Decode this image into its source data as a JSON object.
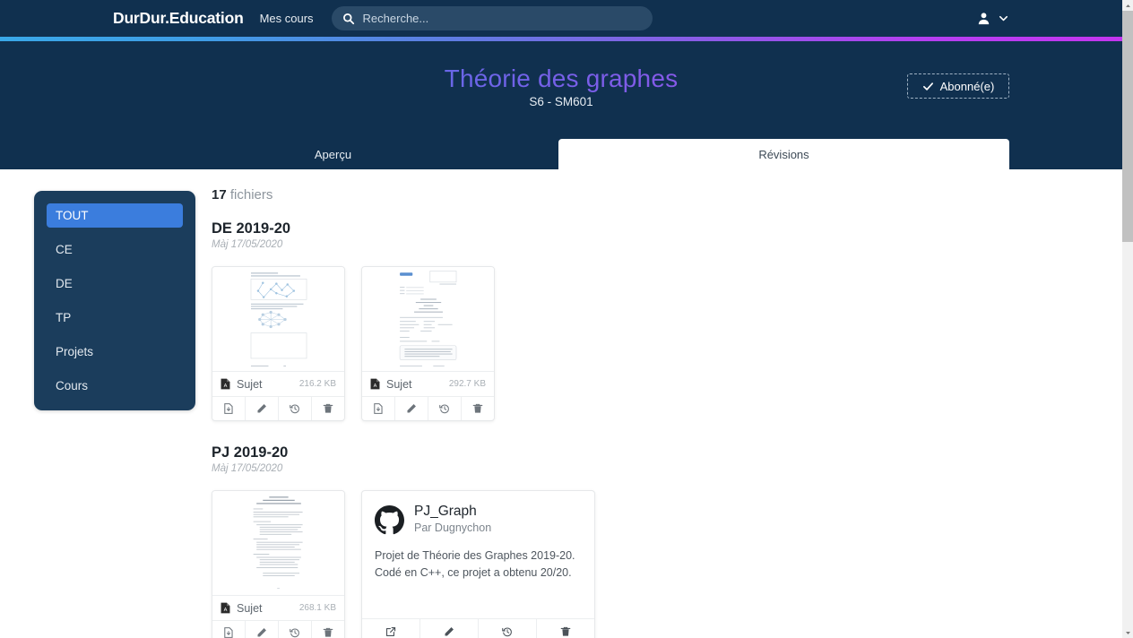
{
  "navbar": {
    "brand": "DurDur.Education",
    "my_courses": "Mes cours",
    "search_placeholder": "Recherche...",
    "search_value": "",
    "icons": {
      "search": "search-icon",
      "user": "user-icon",
      "caret": "chevron-down-icon"
    },
    "background": "#10304f"
  },
  "gradient_bar": {
    "from": "#3aa8e8",
    "to": "#c336ef"
  },
  "hero": {
    "title": "Théorie des graphes",
    "subtitle": "S6 - SM601",
    "subscribe_button": "Abonné(e)",
    "subscribe_icon": "check-icon"
  },
  "tabs": [
    {
      "label": "Aperçu",
      "active": false
    },
    {
      "label": "Révisions",
      "active": true
    }
  ],
  "sidebar": {
    "items": [
      {
        "label": "TOUT",
        "active": true
      },
      {
        "label": "CE",
        "active": false
      },
      {
        "label": "DE",
        "active": false
      },
      {
        "label": "TP",
        "active": false
      },
      {
        "label": "Projets",
        "active": false
      },
      {
        "label": "Cours",
        "active": false
      }
    ],
    "active_color": "#3b7ddd"
  },
  "files": {
    "count_number": "17",
    "count_label": "fichiers",
    "groups": [
      {
        "title": "DE 2019-20",
        "date": "Màj 17/05/2020",
        "cards": [
          {
            "kind": "pdf",
            "name": "Sujet",
            "size": "216.2 KB",
            "thumb": "graph-exam-page",
            "actions": [
              "file-download-icon",
              "pencil-icon",
              "history-icon",
              "trash-icon"
            ]
          },
          {
            "kind": "pdf",
            "name": "Sujet",
            "size": "292.7 KB",
            "thumb": "document-page",
            "actions": [
              "file-download-icon",
              "pencil-icon",
              "history-icon",
              "trash-icon"
            ]
          }
        ]
      },
      {
        "title": "PJ 2019-20",
        "date": "Màj 17/05/2020",
        "cards": [
          {
            "kind": "pdf",
            "name": "Sujet",
            "size": "268.1 KB",
            "thumb": "text-page",
            "actions": [
              "file-download-icon",
              "pencil-icon",
              "history-icon",
              "trash-icon"
            ]
          },
          {
            "kind": "github",
            "repo_name": "PJ_Graph",
            "author": "Par Dugnychon",
            "description": "Projet de Théorie des Graphes 2019-20. Codé en C++, ce projet a obtenu 20/20.",
            "logo": "github-icon",
            "actions": [
              "external-link-icon",
              "pencil-icon",
              "history-icon",
              "trash-icon"
            ]
          }
        ]
      }
    ]
  },
  "scrollbar": {
    "thumb_color": "#c1c1c1",
    "track_color": "#f1f1f1"
  }
}
